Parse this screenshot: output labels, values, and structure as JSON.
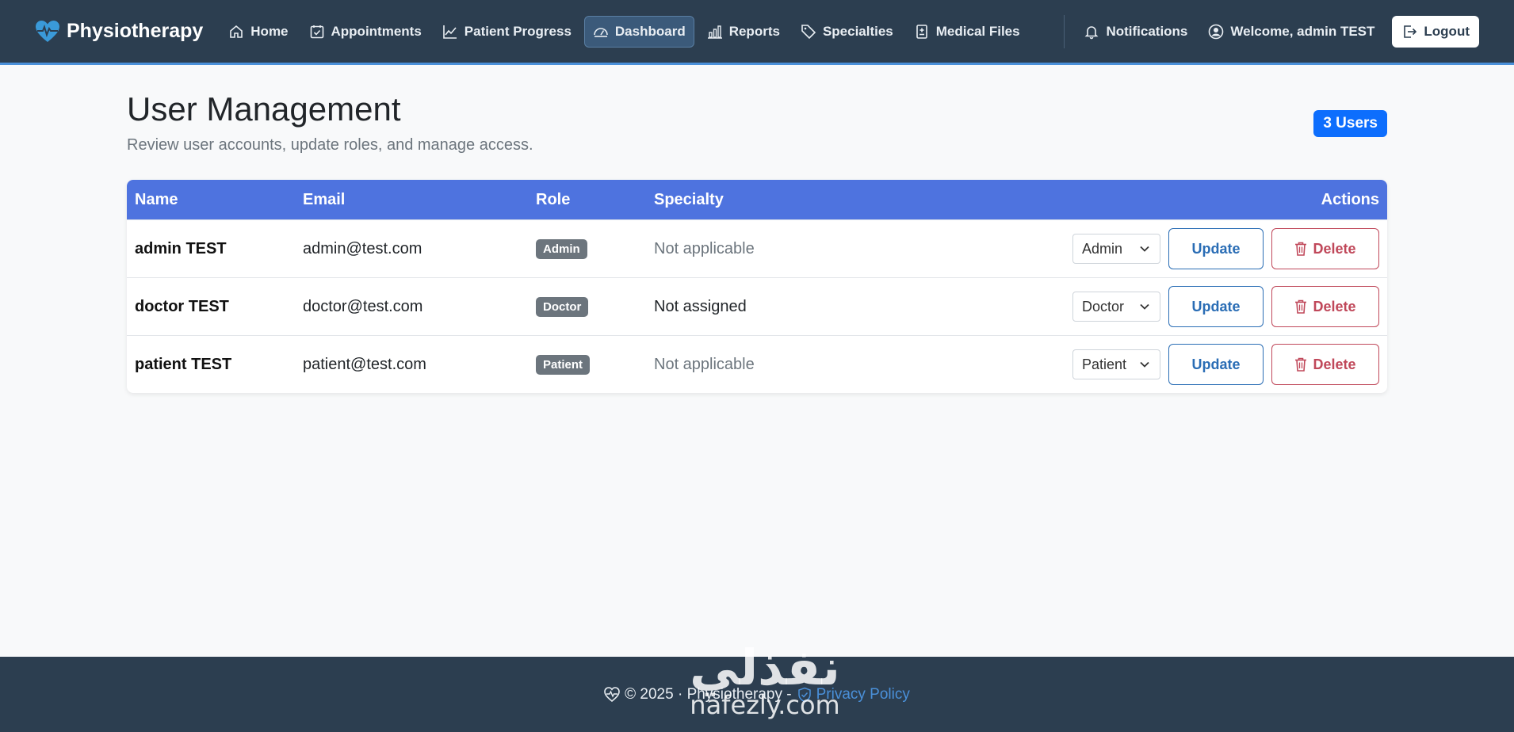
{
  "nav": {
    "brand": "Physiotherapy",
    "links": [
      {
        "label": "Home",
        "icon": "home-icon"
      },
      {
        "label": "Appointments",
        "icon": "calendar-check-icon"
      },
      {
        "label": "Patient Progress",
        "icon": "chart-line-icon"
      },
      {
        "label": "Dashboard",
        "icon": "speedometer-icon",
        "active": true
      },
      {
        "label": "Reports",
        "icon": "bar-chart-icon"
      },
      {
        "label": "Specialties",
        "icon": "tags-icon"
      },
      {
        "label": "Medical Files",
        "icon": "file-medical-icon"
      }
    ],
    "notifications": "Notifications",
    "welcome": "Welcome, admin TEST",
    "logout": "Logout"
  },
  "page": {
    "title": "User Management",
    "subtitle": "Review user accounts, update roles, and manage access.",
    "users_badge": "3 Users"
  },
  "table": {
    "headers": {
      "name": "Name",
      "email": "Email",
      "role": "Role",
      "specialty": "Specialty",
      "actions": "Actions"
    },
    "rows": [
      {
        "name": "admin TEST",
        "email": "admin@test.com",
        "role": "Admin",
        "specialty": "Not applicable",
        "specialty_muted": true,
        "select": "Admin",
        "update": "Update",
        "delete": "Delete"
      },
      {
        "name": "doctor TEST",
        "email": "doctor@test.com",
        "role": "Doctor",
        "specialty": "Not assigned",
        "specialty_muted": false,
        "select": "Doctor",
        "update": "Update",
        "delete": "Delete"
      },
      {
        "name": "patient TEST",
        "email": "patient@test.com",
        "role": "Patient",
        "specialty": "Not applicable",
        "specialty_muted": true,
        "select": "Patient",
        "update": "Update",
        "delete": "Delete"
      }
    ]
  },
  "footer": {
    "copyright": "© 2025 · Physiotherapy -",
    "privacy": "Privacy Policy"
  },
  "watermark": {
    "arabic": "نفذلي",
    "latin": "nafezly.com"
  },
  "colors": {
    "navbar": "#2c3e50",
    "table_header": "#4e73df",
    "badge_primary": "#0d6efd",
    "role_badge": "#6c757d",
    "update": "#2a6db5",
    "delete": "#c0485a"
  }
}
